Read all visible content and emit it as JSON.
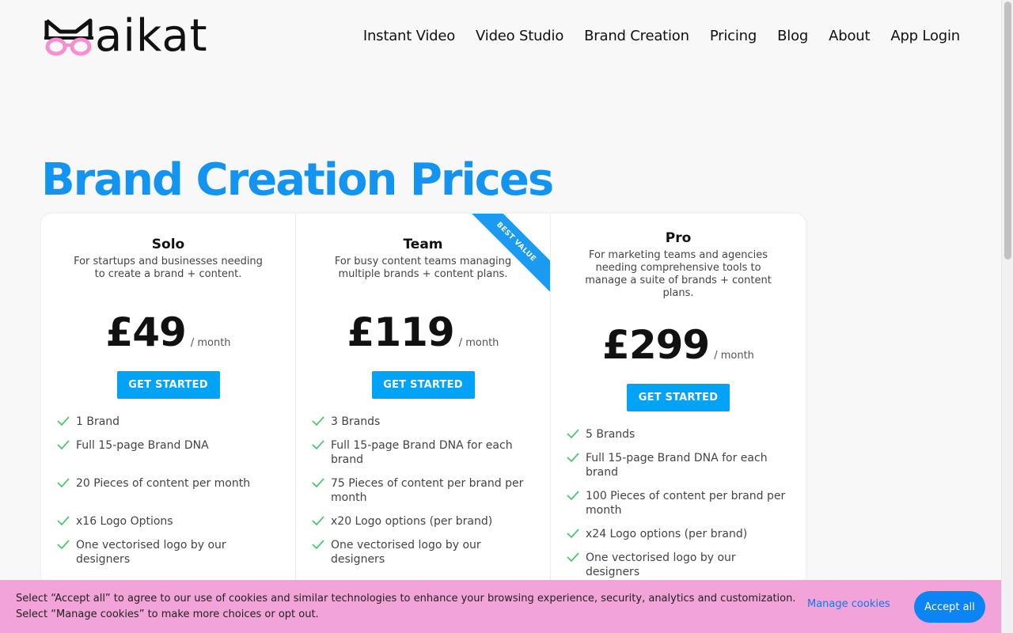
{
  "header": {
    "logo_text": "aikat",
    "nav": [
      "Instant Video",
      "Video Studio",
      "Brand Creation",
      "Pricing",
      "Blog",
      "About",
      "App Login"
    ]
  },
  "page": {
    "title": "Brand Creation Prices"
  },
  "plans": [
    {
      "name": "Solo",
      "description": "For startups and businesses needing to create a brand + content.",
      "price": "£49",
      "period": "/ month",
      "cta": "GET STARTED",
      "features": [
        "1 Brand",
        "Full 15-page Brand DNA",
        "20 Pieces of content per month",
        "x16 Logo Options",
        "One vectorised logo by our designers"
      ]
    },
    {
      "name": "Team",
      "description": "For busy content teams managing multiple brands + content plans.",
      "price": "£119",
      "period": "/ month",
      "cta": "GET STARTED",
      "ribbon": "BEST VALUE",
      "features": [
        "3 Brands",
        "Full 15-page Brand DNA for each brand",
        "75 Pieces of content per brand per month",
        "x20 Logo options (per brand)",
        "One vectorised logo by our designers"
      ]
    },
    {
      "name": "Pro",
      "description": "For marketing teams and agencies needing comprehensive tools to manage a suite of brands + content plans.",
      "price": "£299",
      "period": "/ month",
      "cta": "GET STARTED",
      "features": [
        "5 Brands",
        "Full 15-page Brand DNA for each brand",
        "100 Pieces of content per brand per month",
        "x24 Logo options (per brand)",
        "One vectorised logo by our designers"
      ]
    }
  ],
  "cookie": {
    "text": "Select “Accept all” to agree to our use of cookies and similar technologies to enhance your browsing experience, security, analytics and customization. Select “Manage cookies” to make more choices or opt out.",
    "manage_label": "Manage cookies",
    "accept_label": "Accept all"
  },
  "colors": {
    "accent": "#1294f0",
    "button": "#00a3f5",
    "check": "#4cc870",
    "logo_pink": "#f78fd0",
    "cookie_bg": "#f2a3d8"
  },
  "icons": [
    "cat-glasses-logo-icon",
    "check-icon"
  ]
}
